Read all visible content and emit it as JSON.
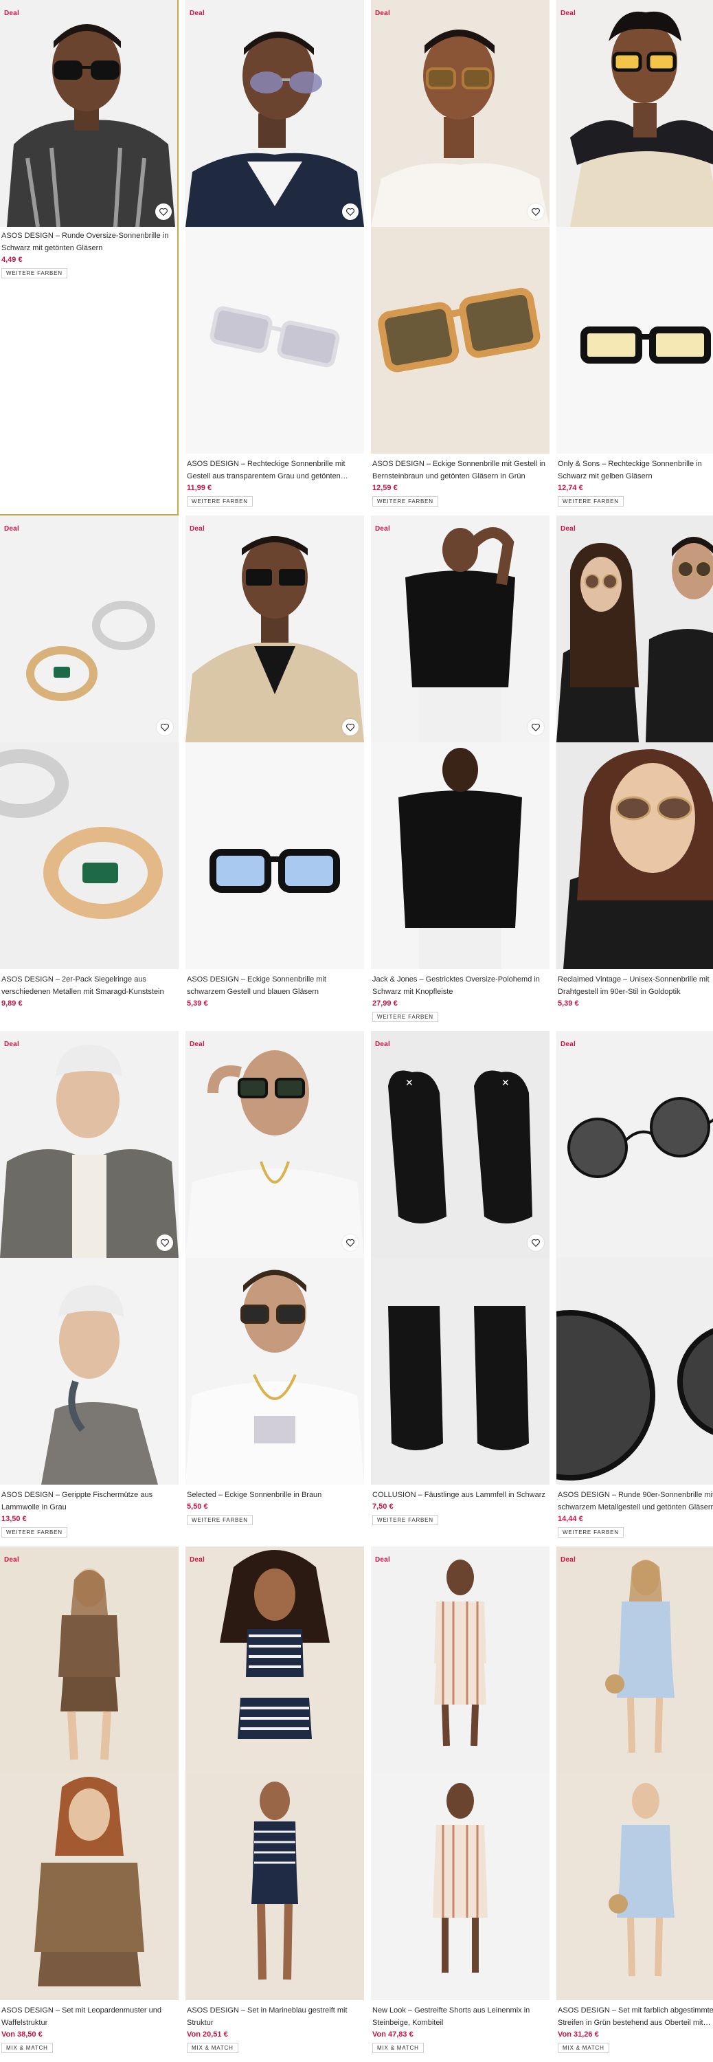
{
  "labels": {
    "deal": "Deal"
  },
  "products": [
    {
      "id": "p1",
      "deal": true,
      "title": "ASOS DESIGN – Runde Oversize-Sonnenbrille in Schwarz mit getönten Gläsern",
      "price": "4,49 €",
      "pill": "WEITERE FARBEN",
      "hovered": true
    },
    {
      "id": "p2",
      "deal": true,
      "title": "ASOS DESIGN – Rechteckige Sonnenbrille mit Gestell aus transparentem Grau und getönten…",
      "price": "11,99 €",
      "pill": "WEITERE FARBEN"
    },
    {
      "id": "p3",
      "deal": true,
      "title": "ASOS DESIGN – Eckige Sonnenbrille mit Gestell in Bernsteinbraun und getönten Gläsern in Grün",
      "price": "12,59 €",
      "pill": "WEITERE FARBEN"
    },
    {
      "id": "p4",
      "deal": true,
      "title": "Only & Sons – Rechteckige Sonnenbrille in Schwarz mit gelben Gläsern",
      "price": "12,74 €",
      "pill": "WEITERE FARBEN"
    },
    {
      "id": "p5",
      "deal": true,
      "title": "ASOS DESIGN – 2er-Pack Siegelringe aus verschiedenen Metallen mit Smaragd-Kunststein",
      "price": "9,89 €",
      "pill": ""
    },
    {
      "id": "p6",
      "deal": true,
      "title": "ASOS DESIGN – Eckige Sonnenbrille mit schwarzem Gestell und blauen Gläsern",
      "price": "5,39 €",
      "pill": ""
    },
    {
      "id": "p7",
      "deal": true,
      "title": "Jack & Jones – Gestricktes Oversize-Polohemd in Schwarz mit Knopfleiste",
      "price": "27,99 €",
      "pill": "WEITERE FARBEN"
    },
    {
      "id": "p8",
      "deal": true,
      "title": "Reclaimed Vintage – Unisex-Sonnenbrille mit Drahtgestell im 90er-Stil in Goldoptik",
      "price": "5,39 €",
      "pill": ""
    },
    {
      "id": "p9",
      "deal": true,
      "title": "ASOS DESIGN – Gerippte Fischermütze aus Lammwolle in Grau",
      "price": "13,50 €",
      "pill": "WEITERE FARBEN"
    },
    {
      "id": "p10",
      "deal": true,
      "title": "Selected – Eckige Sonnenbrille in Braun",
      "price": "5,50 €",
      "pill": "WEITERE FARBEN"
    },
    {
      "id": "p11",
      "deal": true,
      "title": "COLLUSION – Fäustlinge aus Lammfell in Schwarz",
      "price": "7,50 €",
      "pill": "WEITERE FARBEN"
    },
    {
      "id": "p12",
      "deal": true,
      "title": "ASOS DESIGN – Runde 90er-Sonnenbrille mit schwarzem Metallgestell und getönten Gläsern",
      "price": "14,44 €",
      "pill": "WEITERE FARBEN"
    },
    {
      "id": "p13",
      "deal": true,
      "title": "ASOS DESIGN – Set mit Leopardenmuster und Waffelstruktur",
      "price": "Von 38,50 €",
      "pill": "MIX & MATCH"
    },
    {
      "id": "p14",
      "deal": true,
      "title": "ASOS DESIGN – Set in Marineblau gestreift mit Struktur",
      "price": "Von 20,51 €",
      "pill": "MIX & MATCH"
    },
    {
      "id": "p15",
      "deal": true,
      "title": "New Look – Gestreifte Shorts aus Leinenmix in Steinbeige, Kombiteil",
      "price": "Von 47,83 €",
      "pill": "MIX & MATCH"
    },
    {
      "id": "p16",
      "deal": true,
      "title": "ASOS DESIGN – Set mit farblich abgestimmten Streifen in Grün bestehend aus Oberteil mit…",
      "price": "Von 31,26 €",
      "pill": "MIX & MATCH"
    }
  ],
  "colors": {
    "price": "#d01345",
    "deal": "#d01345",
    "hover_border": "#c8a94a"
  }
}
